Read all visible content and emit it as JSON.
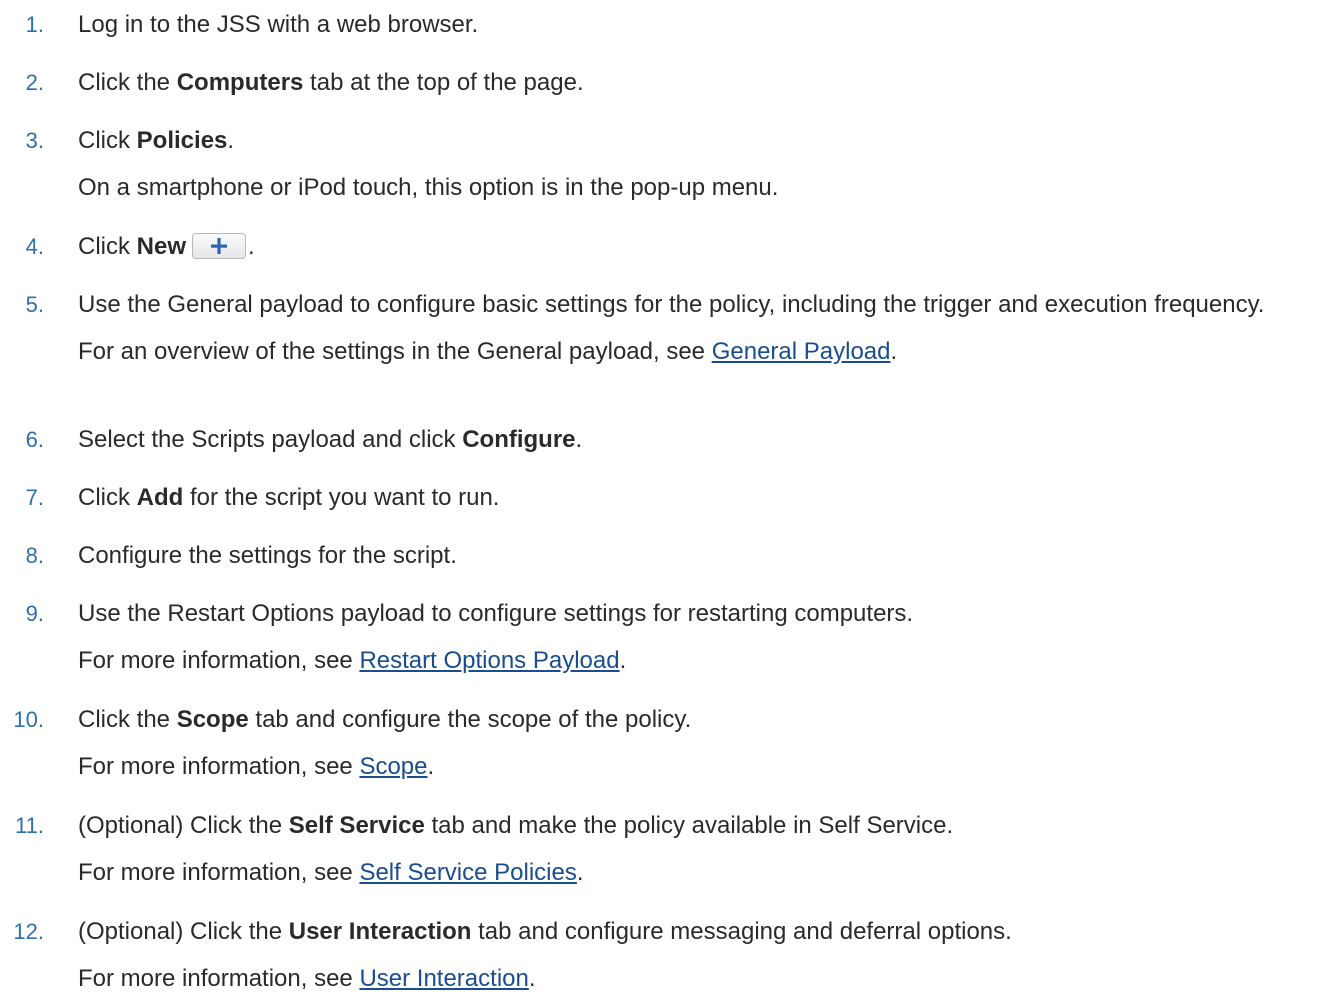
{
  "steps": [
    {
      "num": "1.",
      "main": [
        {
          "t": "Log in to the JSS with a web browser."
        }
      ]
    },
    {
      "num": "2.",
      "main": [
        {
          "t": "Click the "
        },
        {
          "b": "Computers"
        },
        {
          "t": " tab at the top of the page."
        }
      ]
    },
    {
      "num": "3.",
      "main": [
        {
          "t": "Click "
        },
        {
          "b": "Policies"
        },
        {
          "t": "."
        }
      ],
      "sub": [
        {
          "t": "On a smartphone or iPod touch, this option is in the pop-up menu."
        }
      ]
    },
    {
      "num": "4.",
      "main": [
        {
          "t": "Click "
        },
        {
          "b": "New"
        },
        {
          "btn": "plus-icon"
        },
        {
          "t": "."
        }
      ]
    },
    {
      "num": "5.",
      "main": [
        {
          "t": "Use the General payload to configure basic settings for the policy, including the trigger and execution frequency."
        }
      ],
      "sub": [
        {
          "t": "For an overview of the settings in the General payload, see "
        },
        {
          "a": "General Payload"
        },
        {
          "t": "."
        }
      ]
    },
    {
      "num": "6.",
      "main": [
        {
          "t": "Select the Scripts payload and click "
        },
        {
          "b": "Configure"
        },
        {
          "t": "."
        }
      ]
    },
    {
      "num": "7.",
      "main": [
        {
          "t": "Click "
        },
        {
          "b": "Add"
        },
        {
          "t": " for the script you want to run."
        }
      ]
    },
    {
      "num": "8.",
      "main": [
        {
          "t": "Configure the settings for the script."
        }
      ]
    },
    {
      "num": "9.",
      "main": [
        {
          "t": "Use the Restart Options payload to configure settings for restarting computers."
        }
      ],
      "sub": [
        {
          "t": "For more information, see "
        },
        {
          "a": " Restart Options Payload"
        },
        {
          "t": "."
        }
      ]
    },
    {
      "num": "10.",
      "main": [
        {
          "t": "Click the "
        },
        {
          "b": "Scope"
        },
        {
          "t": " tab and configure the scope of the policy."
        }
      ],
      "sub": [
        {
          "t": "For more information, see "
        },
        {
          "a": "Scope"
        },
        {
          "t": "."
        }
      ]
    },
    {
      "num": "11.",
      "main": [
        {
          "t": "(Optional) Click the "
        },
        {
          "b": "Self Service"
        },
        {
          "t": " tab and make the policy available in Self Service."
        }
      ],
      "sub": [
        {
          "t": "For more information, see "
        },
        {
          "a": "Self Service Policies"
        },
        {
          "t": "."
        }
      ]
    },
    {
      "num": "12.",
      "main": [
        {
          "t": "(Optional) Click the "
        },
        {
          "b": "User Interaction"
        },
        {
          "t": " tab and configure messaging and deferral options."
        }
      ],
      "sub": [
        {
          "t": "For more information, see "
        },
        {
          "a": "User Interaction"
        },
        {
          "t": "."
        }
      ]
    }
  ]
}
